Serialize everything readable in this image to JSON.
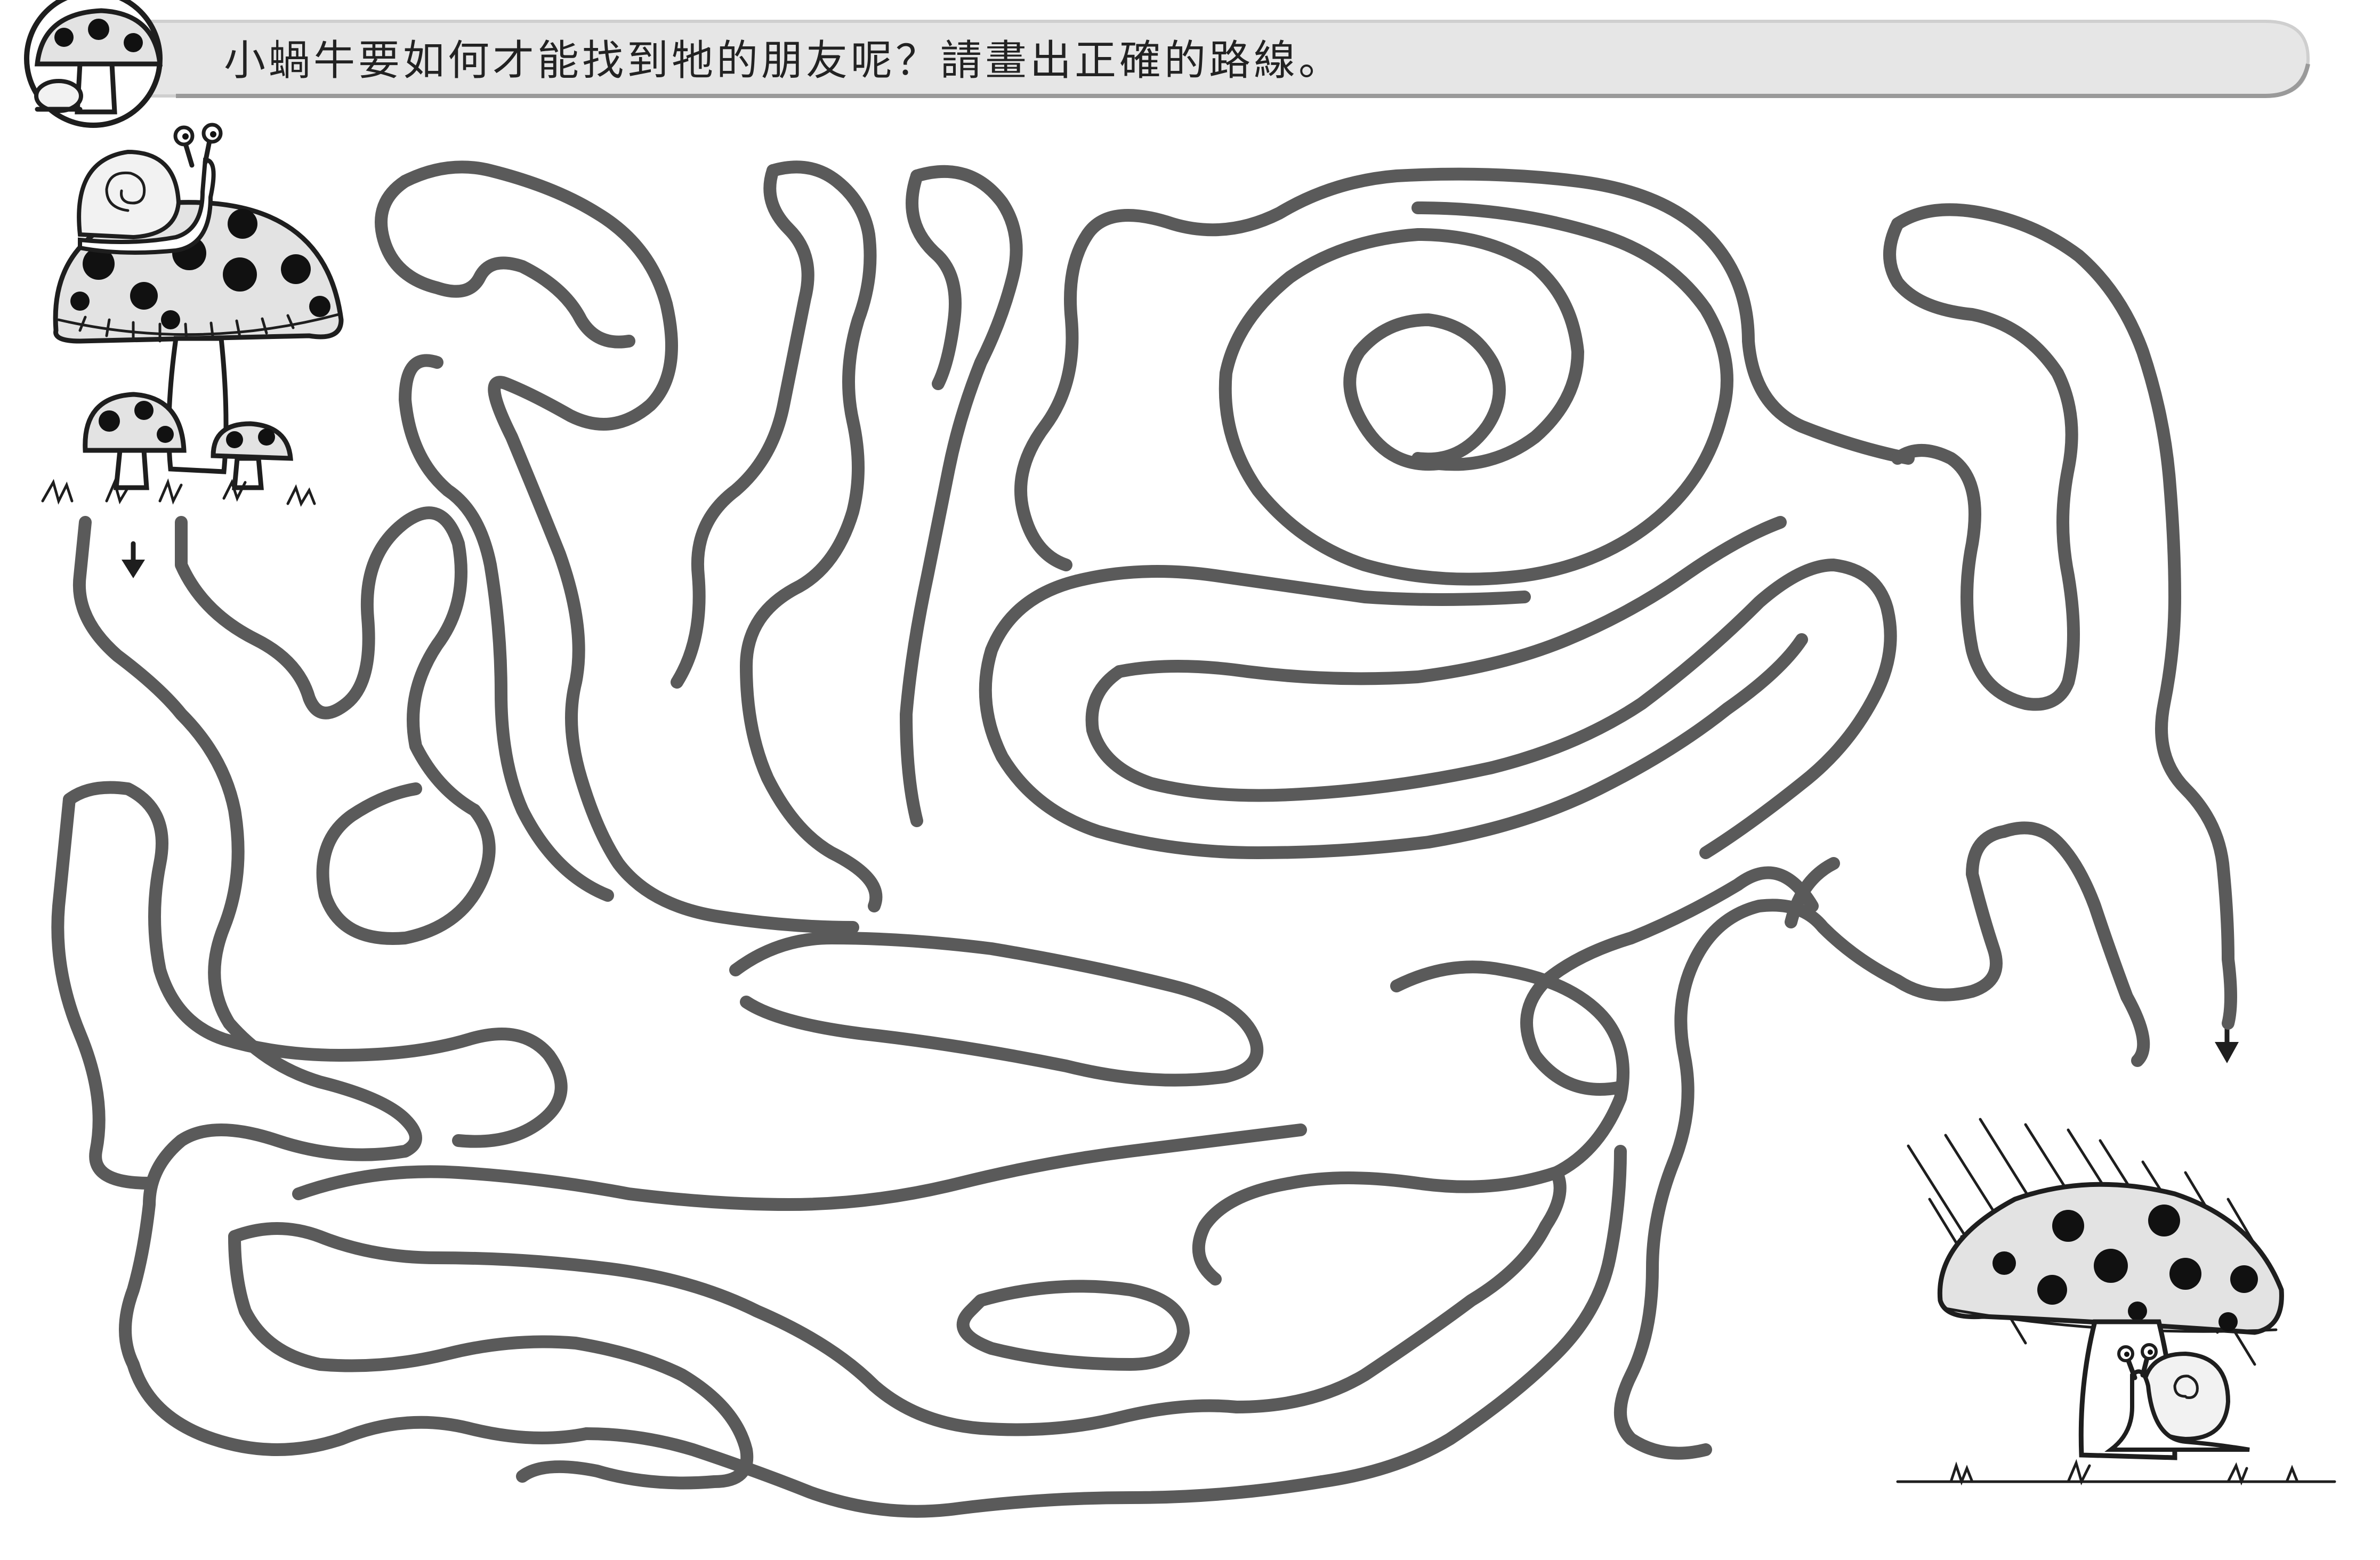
{
  "header": {
    "instruction": "小蝸牛要如何才能找到牠的朋友呢？請畫出正確的路線。"
  },
  "icons": {
    "start": "snail-on-mushroom-icon",
    "finish": "snail-under-mushroom-icon",
    "badge": "mushroom-badge-icon"
  },
  "colors": {
    "maze_wall": "#5a5a5a",
    "banner": "#e6e6e6",
    "ink": "#1e1e1e"
  }
}
